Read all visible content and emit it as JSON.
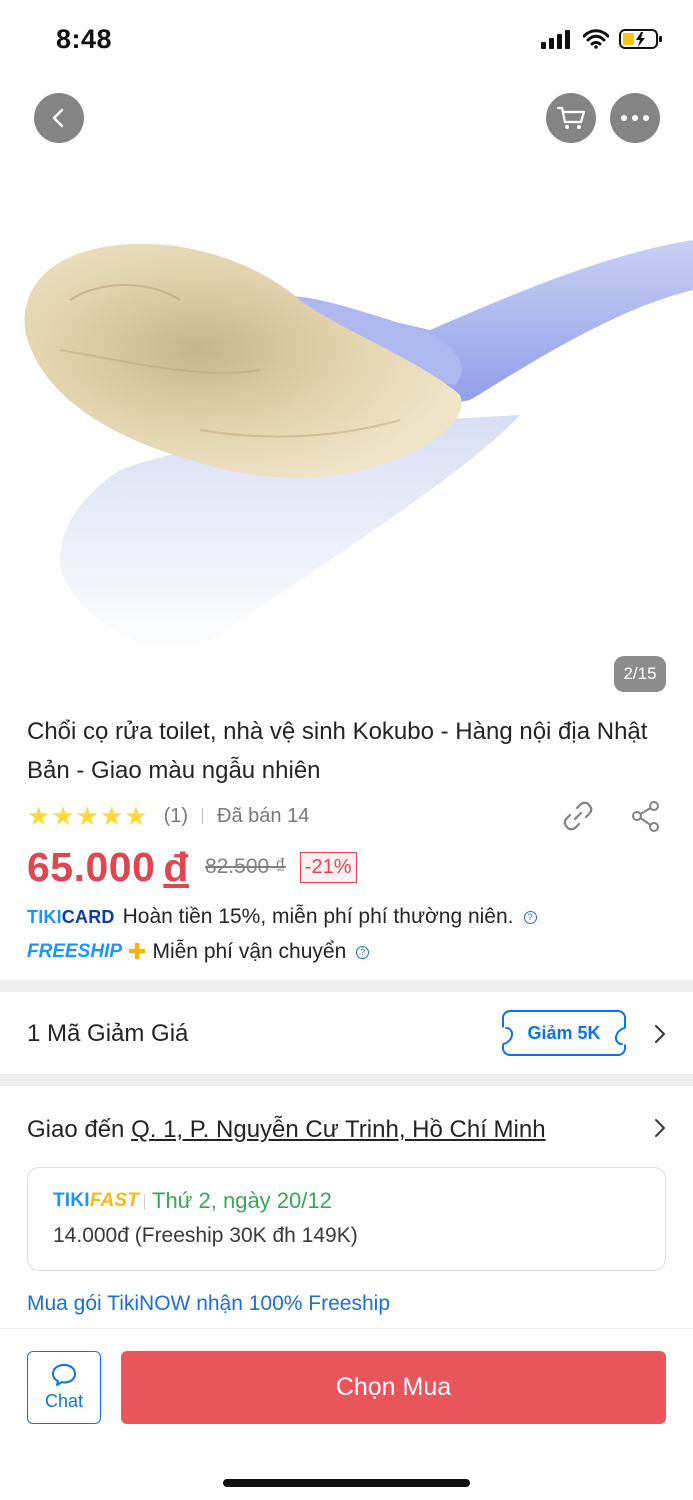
{
  "status_bar": {
    "time": "8:48"
  },
  "header": {
    "back_icon": "chevron-left-icon",
    "cart_icon": "shopping-cart-icon",
    "more_icon": "more-dots-icon"
  },
  "gallery": {
    "counter": "2/15"
  },
  "product": {
    "title": "Chổi cọ rửa toilet, nhà vệ sinh Kokubo - Hàng nội địa Nhật Bản - Giao màu ngẫu nhiên",
    "rating": 5,
    "review_count": "(1)",
    "sold": "Đã bán 14",
    "price": "65.000",
    "currency": "đ",
    "old_price": "82.500 ₫",
    "discount": "-21%",
    "accent_color": "#e0464f"
  },
  "promos": {
    "tikicard_brand_1": "TIKI",
    "tikicard_brand_2": "CARD",
    "tikicard_text": "Hoàn tiền 15%, miễn phí phí thường niên.",
    "freeship_brand": "FREESHIP",
    "freeship_plus": "✚",
    "freeship_text": "Miễn phí vận chuyển",
    "info_glyph": "?"
  },
  "coupon": {
    "label": "1 Mã Giảm Giá",
    "tag": "Giảm 5K"
  },
  "delivery": {
    "prefix": "Giao đến",
    "address": "Q. 1, P. Nguyễn Cư Trinh, Hồ Chí Minh",
    "brand_1": "TIKI",
    "brand_2": "FAST",
    "date": "Thứ 2, ngày 20/12",
    "fee": "14.000đ (Freeship 30K đh 149K)",
    "tikinow_link": "Mua gói TikiNOW nhận 100% Freeship",
    "date_color": "#37a853"
  },
  "bottom_bar": {
    "chat_label": "Chat",
    "buy_label": "Chọn Mua",
    "buy_color": "#e9555b"
  }
}
